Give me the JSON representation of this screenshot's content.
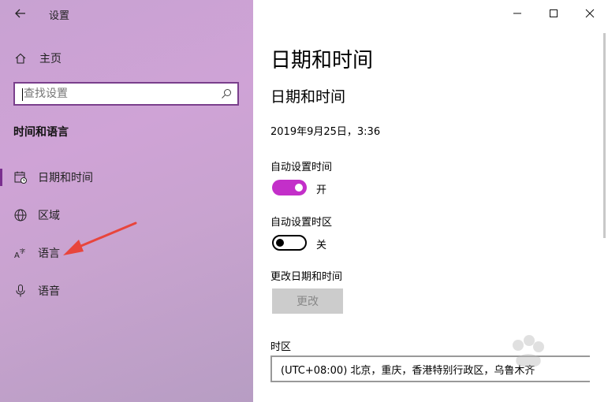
{
  "window": {
    "app_title": "设置",
    "controls": {
      "minimize": "—",
      "maximize": "☐",
      "close": "✕"
    }
  },
  "sidebar": {
    "home_label": "主页",
    "search": {
      "placeholder": "查找设置",
      "value": ""
    },
    "section_title": "时间和语言",
    "items": [
      {
        "label": "日期和时间",
        "icon": "clock-calendar-icon",
        "active": true
      },
      {
        "label": "区域",
        "icon": "globe-icon",
        "active": false
      },
      {
        "label": "语言",
        "icon": "language-icon",
        "active": false
      },
      {
        "label": "语音",
        "icon": "microphone-icon",
        "active": false
      }
    ]
  },
  "main": {
    "page_title": "日期和时间",
    "section_title": "日期和时间",
    "current_datetime": "2019年9月25日，3:36",
    "auto_time": {
      "label": "自动设置时间",
      "state": "开",
      "on": true
    },
    "auto_timezone": {
      "label": "自动设置时区",
      "state": "关",
      "on": false
    },
    "change_datetime": {
      "label": "更改日期和时间",
      "button_label": "更改"
    },
    "timezone": {
      "label": "时区",
      "value": "(UTC+08:00) 北京，重庆，香港特别行政区，乌鲁木齐"
    }
  },
  "colors": {
    "accent": "#c32fc9",
    "sidebar_active_bar": "#7a2f8f",
    "annotation_arrow": "#e8453c"
  }
}
